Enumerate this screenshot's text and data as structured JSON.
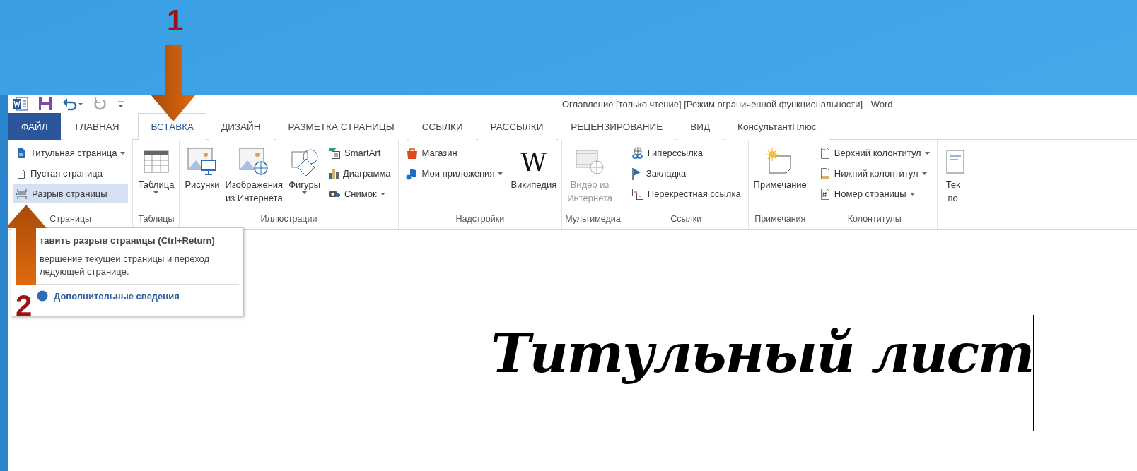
{
  "slide": {
    "markers": [
      {
        "label": "1"
      },
      {
        "label": "2"
      }
    ]
  },
  "window": {
    "title": "Оглавление [только чтение] [Режим ограниченной функциональности] - Word"
  },
  "tabs": [
    {
      "label": "ФАЙЛ",
      "kind": "file",
      "selected": false
    },
    {
      "label": "ГЛАВНАЯ",
      "kind": "tab",
      "selected": false
    },
    {
      "label": "ВСТАВКА",
      "kind": "tab",
      "selected": true
    },
    {
      "label": "ДИЗАЙН",
      "kind": "tab",
      "selected": false
    },
    {
      "label": "РАЗМЕТКА СТРАНИЦЫ",
      "kind": "tab",
      "selected": false
    },
    {
      "label": "ССЫЛКИ",
      "kind": "tab",
      "selected": false
    },
    {
      "label": "РАССЫЛКИ",
      "kind": "tab",
      "selected": false
    },
    {
      "label": "РЕЦЕНЗИРОВАНИЕ",
      "kind": "tab",
      "selected": false
    },
    {
      "label": "ВИД",
      "kind": "tab",
      "selected": false
    },
    {
      "label": "КонсультантПлюс",
      "kind": "tab",
      "selected": false
    }
  ],
  "ribbon": {
    "groups": [
      {
        "label": "Страницы",
        "items": [
          {
            "kind": "stack",
            "items": [
              {
                "label": "Титульная страница",
                "dropdown": true,
                "selected": false
              },
              {
                "label": "Пустая страница",
                "dropdown": false,
                "selected": false
              },
              {
                "label": "Разрыв страницы",
                "dropdown": false,
                "selected": true
              }
            ]
          }
        ]
      },
      {
        "label": "Таблицы",
        "items": [
          {
            "kind": "large",
            "lines": [
              "Таблица"
            ],
            "dropdown": true,
            "disabled": false
          }
        ]
      },
      {
        "label": "Иллюстрации",
        "items": [
          {
            "kind": "large",
            "lines": [
              "Рисунки"
            ],
            "dropdown": false,
            "disabled": false
          },
          {
            "kind": "large",
            "lines": [
              "Изображения",
              "из Интернета"
            ],
            "dropdown": false,
            "disabled": false
          },
          {
            "kind": "large",
            "lines": [
              "Фигуры"
            ],
            "dropdown": true,
            "disabled": false
          },
          {
            "kind": "stack",
            "items": [
              {
                "label": "SmartArt",
                "dropdown": false,
                "selected": false
              },
              {
                "label": "Диаграмма",
                "dropdown": false,
                "selected": false
              },
              {
                "label": "Снимок",
                "dropdown": true,
                "selected": false
              }
            ]
          }
        ]
      },
      {
        "label": "Надстройки",
        "items": [
          {
            "kind": "stack",
            "items": [
              {
                "label": "Магазин",
                "dropdown": false,
                "selected": false
              },
              {
                "label": "Мои приложения",
                "dropdown": true,
                "selected": false
              }
            ]
          },
          {
            "kind": "large",
            "icon_text": "W",
            "lines": [
              "Википедия"
            ],
            "dropdown": false,
            "disabled": false
          }
        ]
      },
      {
        "label": "Мультимедиа",
        "items": [
          {
            "kind": "large",
            "lines": [
              "Видео из",
              "Интернета"
            ],
            "dropdown": false,
            "disabled": true
          }
        ]
      },
      {
        "label": "Ссылки",
        "items": [
          {
            "kind": "stack",
            "items": [
              {
                "label": "Гиперссылка",
                "dropdown": false,
                "selected": false
              },
              {
                "label": "Закладка",
                "dropdown": false,
                "selected": false
              },
              {
                "label": "Перекрестная ссылка",
                "dropdown": false,
                "selected": false
              }
            ]
          }
        ]
      },
      {
        "label": "Примечания",
        "items": [
          {
            "kind": "large",
            "lines": [
              "Примечание"
            ],
            "dropdown": false,
            "disabled": false
          }
        ]
      },
      {
        "label": "Колонтитулы",
        "items": [
          {
            "kind": "stack",
            "items": [
              {
                "label": "Верхний колонтитул",
                "dropdown": true,
                "selected": false
              },
              {
                "label": "Нижний колонтитул",
                "dropdown": true,
                "selected": false
              },
              {
                "label": "Номер страницы",
                "dropdown": true,
                "selected": false
              }
            ]
          }
        ]
      },
      {
        "items": [
          {
            "kind": "large",
            "lines": [
              "Тек",
              "по"
            ],
            "dropdown": false,
            "disabled": false
          }
        ]
      }
    ]
  },
  "tooltip": {
    "title": "тавить разрыв страницы (Ctrl+Return)",
    "lines": [
      "вершение текущей страницы и переход",
      "ледующей странице."
    ],
    "link": "Дополнительные сведения"
  },
  "document": {
    "heading": "Титульный лист"
  }
}
